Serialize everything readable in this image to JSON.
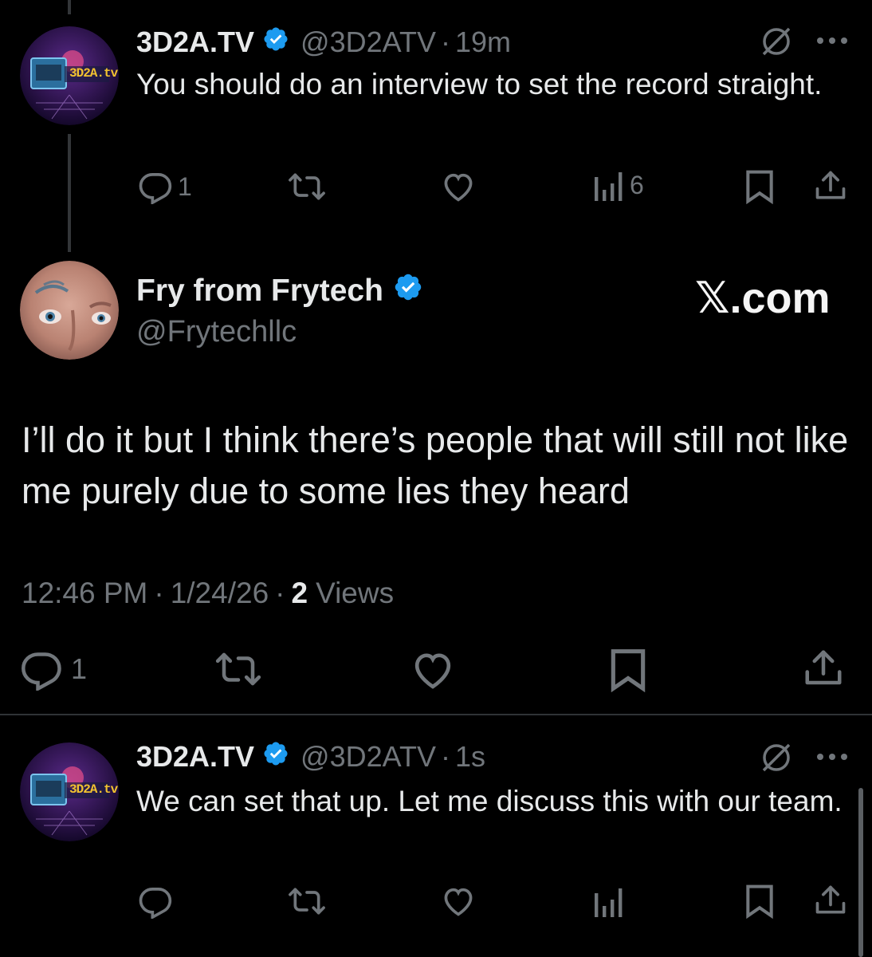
{
  "tweets": [
    {
      "name": "3D2A.TV",
      "handle": "@3D2ATV",
      "sep": "·",
      "time": "19m",
      "text": "You should do an interview to set the record straight.",
      "replies": "1",
      "views": "6",
      "avatar_text": "3D2A.tv"
    },
    {
      "name": "3D2A.TV",
      "handle": "@3D2ATV",
      "sep": "·",
      "time": "1s",
      "text": "We can set that up. Let me discuss this with our team.",
      "replies": "",
      "views": "",
      "avatar_text": "3D2A.tv"
    }
  ],
  "main": {
    "name": "Fry from Frytech",
    "handle": "@Frytechllc",
    "watermark": "𝕏.com",
    "text": "I’ll do it but I think there’s people that will still not like me purely due to some lies they heard",
    "time": "12:46 PM",
    "date": "1/24/26",
    "sep": "·",
    "views_count": "2",
    "views_label": "Views",
    "replies": "1"
  },
  "colors": {
    "background": "#000000",
    "text": "#e7e9ea",
    "muted": "#71767b",
    "verified": "#1d9bf0",
    "divider": "#2f3336"
  }
}
